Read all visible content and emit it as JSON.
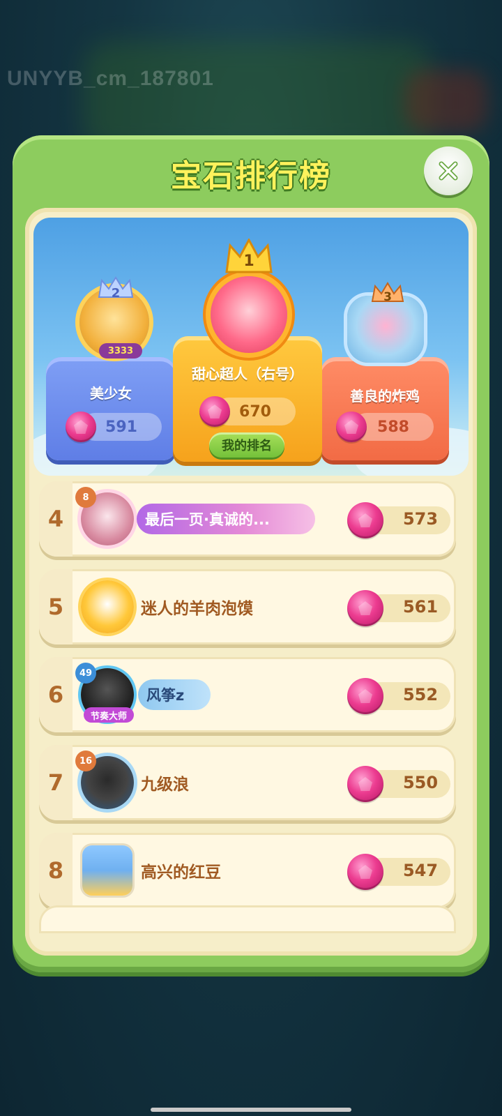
{
  "watermark": "UNYYB_cm_187801",
  "modal": {
    "title": "宝石排行榜",
    "close_icon": "close-icon"
  },
  "podium": {
    "first": {
      "rank": "1",
      "name": "甜心超人（右号）",
      "gems": "670",
      "my_rank_label": "我的排名"
    },
    "second": {
      "rank": "2",
      "name": "美少女",
      "gems": "591",
      "badge": "3333"
    },
    "third": {
      "rank": "3",
      "name": "善良的炸鸡",
      "gems": "588"
    }
  },
  "list": [
    {
      "rank": "4",
      "name": "最后一页·真诚的...",
      "gems": "573",
      "level": "8"
    },
    {
      "rank": "5",
      "name": "迷人的羊肉泡馍",
      "gems": "561"
    },
    {
      "rank": "6",
      "name": "风筝z",
      "gems": "552",
      "level": "49",
      "title_tag": "节奏大师"
    },
    {
      "rank": "7",
      "name": "九级浪",
      "gems": "550",
      "level": "16"
    },
    {
      "rank": "8",
      "name": "高兴的红豆",
      "gems": "547"
    }
  ],
  "colors": {
    "modal_green": "#8dcc5e",
    "title_yellow": "#fff25c",
    "gem_pink": "#ec3c90",
    "rank_brown": "#b06a2c"
  }
}
